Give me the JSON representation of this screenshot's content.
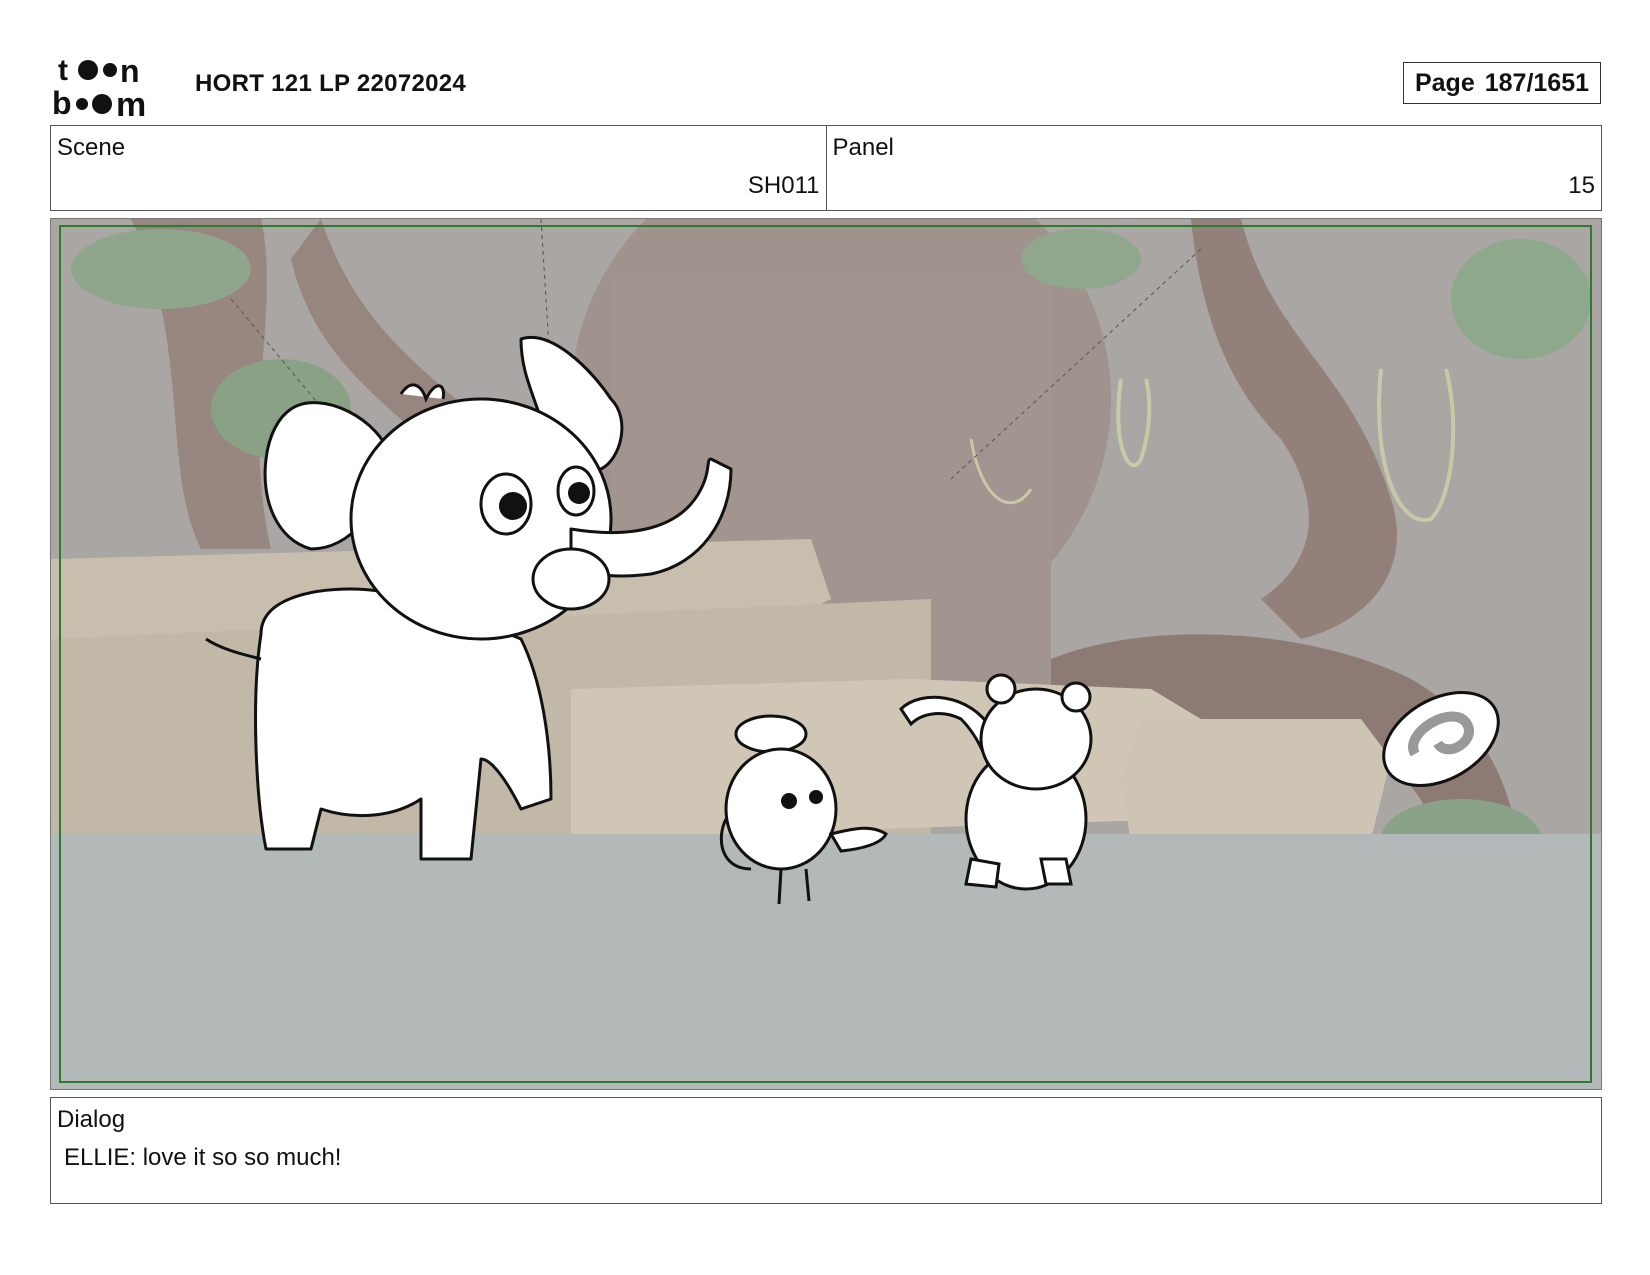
{
  "header": {
    "logo_text": "toon boom",
    "logo_icon": "toon-boom-logo",
    "title": "HORT 121 LP 22072024",
    "page_label": "Page",
    "page_value": "187/1651"
  },
  "scene": {
    "label": "Scene",
    "value": "SH011"
  },
  "panel": {
    "label": "Panel",
    "value": "15"
  },
  "artwork": {
    "description_icon": "storyboard-sketch",
    "colors": {
      "frame": "#2f7a2f",
      "ground": "#b5babb",
      "background": "#a9a6a4"
    }
  },
  "dialog": {
    "label": "Dialog",
    "text": "ELLIE: love it so so much!"
  }
}
